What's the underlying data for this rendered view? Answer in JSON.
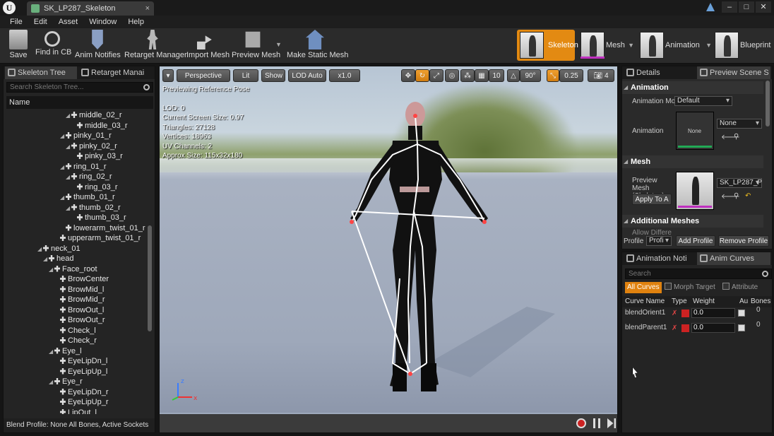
{
  "titlebar": {
    "tab_title": "SK_LP287_Skeleton",
    "logo": "U"
  },
  "menu": [
    "File",
    "Edit",
    "Asset",
    "Window",
    "Help"
  ],
  "toolbar": {
    "save": "Save",
    "find_in_cb": "Find in CB",
    "anim_notifies": "Anim Notifies",
    "retarget_manager": "Retarget Manager",
    "import_mesh": "Import Mesh",
    "preview_mesh": "Preview Mesh",
    "make_static_mesh": "Make Static Mesh"
  },
  "modes": [
    "Skeleton",
    "Mesh",
    "Animation",
    "Blueprint"
  ],
  "left_panel": {
    "tab_skeleton_tree": "Skeleton Tree",
    "tab_retarget": "Retarget Manai",
    "search_placeholder": "Search Skeleton Tree...",
    "col_name": "Name",
    "bones": [
      {
        "name": "middle_02_r",
        "indent": 5,
        "exp": true
      },
      {
        "name": "middle_03_r",
        "indent": 6,
        "exp": false
      },
      {
        "name": "pinky_01_r",
        "indent": 4,
        "exp": true
      },
      {
        "name": "pinky_02_r",
        "indent": 5,
        "exp": true
      },
      {
        "name": "pinky_03_r",
        "indent": 6,
        "exp": false
      },
      {
        "name": "ring_01_r",
        "indent": 4,
        "exp": true
      },
      {
        "name": "ring_02_r",
        "indent": 5,
        "exp": true
      },
      {
        "name": "ring_03_r",
        "indent": 6,
        "exp": false
      },
      {
        "name": "thumb_01_r",
        "indent": 4,
        "exp": true
      },
      {
        "name": "thumb_02_r",
        "indent": 5,
        "exp": true
      },
      {
        "name": "thumb_03_r",
        "indent": 6,
        "exp": false
      },
      {
        "name": "lowerarm_twist_01_r",
        "indent": 4,
        "exp": false
      },
      {
        "name": "upperarm_twist_01_r",
        "indent": 3,
        "exp": false
      },
      {
        "name": "neck_01",
        "indent": 0,
        "exp": true
      },
      {
        "name": "head",
        "indent": 1,
        "exp": true
      },
      {
        "name": "Face_root",
        "indent": 2,
        "exp": true
      },
      {
        "name": "BrowCenter",
        "indent": 3,
        "exp": false
      },
      {
        "name": "BrowMid_l",
        "indent": 3,
        "exp": false
      },
      {
        "name": "BrowMid_r",
        "indent": 3,
        "exp": false
      },
      {
        "name": "BrowOut_l",
        "indent": 3,
        "exp": false
      },
      {
        "name": "BrowOut_r",
        "indent": 3,
        "exp": false
      },
      {
        "name": "Check_l",
        "indent": 3,
        "exp": false
      },
      {
        "name": "Check_r",
        "indent": 3,
        "exp": false
      },
      {
        "name": "Eye_l",
        "indent": 2,
        "exp": true
      },
      {
        "name": "EyeLipDn_l",
        "indent": 3,
        "exp": false
      },
      {
        "name": "EyeLipUp_l",
        "indent": 3,
        "exp": false
      },
      {
        "name": "Eye_r",
        "indent": 2,
        "exp": true
      },
      {
        "name": "EyeLipDn_r",
        "indent": 3,
        "exp": false
      },
      {
        "name": "EyeLipUp_r",
        "indent": 3,
        "exp": false
      },
      {
        "name": "LipOut_l",
        "indent": 3,
        "exp": false
      }
    ],
    "bottom": "Blend Profile: None  All Bones, Active Sockets"
  },
  "viewport": {
    "perspective": "Perspective",
    "lit": "Lit",
    "show": "Show",
    "lod": "LOD Auto",
    "speed": "x1.0",
    "grid": "10",
    "angle": "90°",
    "scale": "0.25",
    "cams": "4",
    "info": [
      "Previewing Reference Pose",
      "",
      "LOD: 0",
      "Current Screen Size: 0.97",
      "Triangles: 27128",
      "Vertices: 18963",
      "UV Channels: 2",
      "Approx Size: 115x32x180"
    ]
  },
  "details": {
    "tab_details": "Details",
    "tab_preview": "Preview Scene S",
    "section_animation": "Animation",
    "anim_mode_label": "Animation Mo",
    "anim_mode": "Default",
    "animation_label": "Animation",
    "anim_thumb": "None",
    "anim_value": "None",
    "section_mesh": "Mesh",
    "preview_mesh_label": "Preview Mesh (Skeleton)",
    "apply_btn": "Apply To A",
    "mesh_value": "SK_LP287_P",
    "section_additional": "Additional Meshes",
    "allow_diff": "Allow Differe",
    "profile_label": "Profile",
    "profile_combo": "Profi",
    "add_profile": "Add Profile",
    "remove_profile": "Remove Profile"
  },
  "curves": {
    "tab_notifies": "Animation Noti",
    "tab_curves": "Anim Curves",
    "search_placeholder": "Search",
    "all_curves": "All Curves",
    "morph_target": "Morph Target",
    "attribute": "Attribute",
    "headers": {
      "name": "Curve Name",
      "type": "Type",
      "weight": "Weight",
      "auto": "Au",
      "bones": "Bones"
    },
    "rows": [
      {
        "name": "blendOrient1",
        "weight": "0.0",
        "bones": "0"
      },
      {
        "name": "blendParent1",
        "weight": "0.0",
        "bones": "0"
      }
    ]
  },
  "colors": {
    "accent": "#e38a12",
    "mesh_bar": "#c030c0"
  }
}
